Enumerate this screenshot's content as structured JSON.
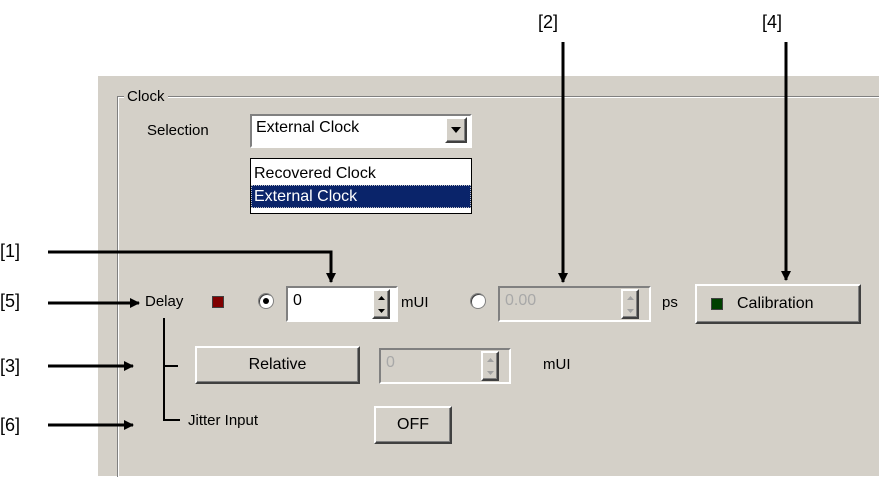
{
  "callouts": [
    "[1]",
    "[2]",
    "[3]",
    "[4]",
    "[5]",
    "[6]"
  ],
  "clock": {
    "group_label": "Clock",
    "selection_label": "Selection",
    "selection_value": "External Clock",
    "options": [
      "Recovered Clock",
      "External Clock"
    ],
    "selected_option_index": 1,
    "delay_label": "Delay",
    "delay_led_color": "#800000",
    "mui_value": "0",
    "mui_unit": "mUI",
    "ps_value": "0.00",
    "ps_unit": "ps",
    "calibration_label": "Calibration",
    "calibration_led_color": "#004000",
    "relative_label": "Relative",
    "relative_value": "0",
    "relative_unit": "mUI",
    "jitter_label": "Jitter Input",
    "jitter_value": "OFF"
  }
}
